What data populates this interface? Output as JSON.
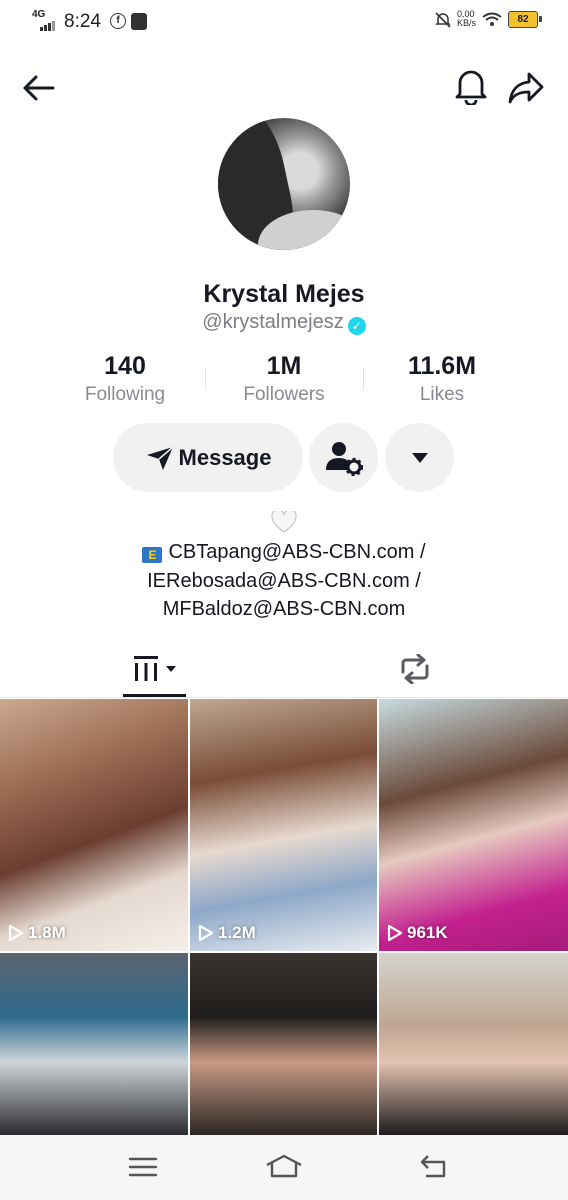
{
  "status_bar": {
    "network": "4G",
    "time": "8:24",
    "speed_value": "0.00",
    "speed_unit": "KB/s",
    "battery": "82"
  },
  "icons": {
    "back": "arrow-left-icon",
    "bell": "bell-icon",
    "share": "share-icon",
    "message": "paper-plane-icon",
    "add_friend": "person-settings-icon",
    "dropdown": "caret-down-icon",
    "videos_tab": "grid-bars-icon",
    "reposts_tab": "repost-icon"
  },
  "profile": {
    "name": "Krystal Mejes",
    "handle": "@krystalmejesz",
    "verified": true
  },
  "stats": [
    {
      "value": "140",
      "label": "Following"
    },
    {
      "value": "1M",
      "label": "Followers"
    },
    {
      "value": "11.6M",
      "label": "Likes"
    }
  ],
  "actions": {
    "message_label": "Message"
  },
  "bio": {
    "line1": "CBTapang@ABS-CBN.com /",
    "line2": "IERebosada@ABS-CBN.com /",
    "line3": "MFBaldoz@ABS-CBN.com"
  },
  "videos": [
    {
      "views": "1.8M"
    },
    {
      "views": "1.2M"
    },
    {
      "views": "961K"
    },
    {
      "views": ""
    },
    {
      "views": ""
    },
    {
      "views": ""
    }
  ],
  "colors": {
    "verified": "#20d5ec",
    "button_bg": "#f1f1f2",
    "muted_text": "#8a8b91"
  }
}
